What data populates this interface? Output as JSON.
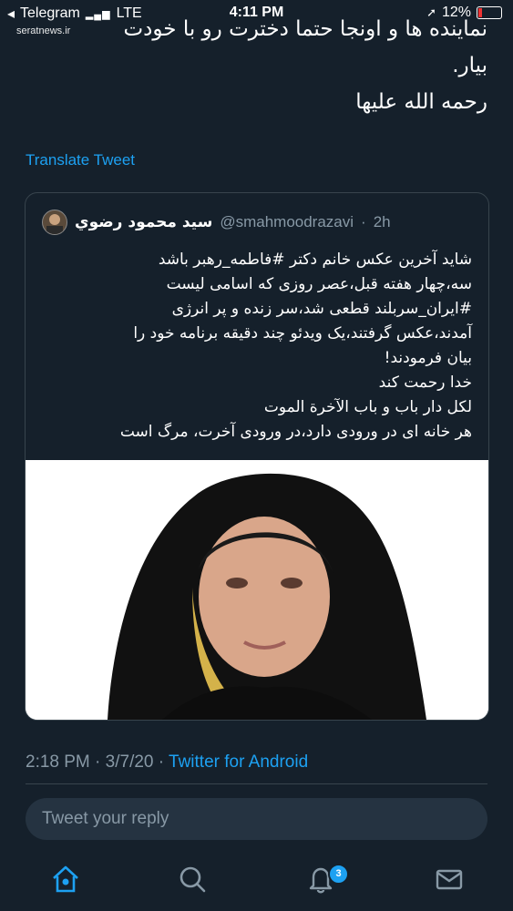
{
  "status_bar": {
    "carrier": "Telegram",
    "network": "LTE",
    "time": "4:11 PM",
    "battery": "12%"
  },
  "watermark": "seratnews.ir",
  "tweet_text_tail": "نماینده ها و اونجا حتما دخترت رو با خودت\nبیار.\nرحمه الله علیها",
  "translate_label": "Translate Tweet",
  "quoted_tweet": {
    "name": "سید محمود رضوي",
    "handle": "@smahmoodrazavi",
    "age": "2h",
    "text": "شاید آخرین عکس خانم دکتر #فاطمه_رهبر باشد\nسه،چهار هفته قبل،عصر روزی که اسامی لیست\n#ایران_سربلند قطعی شد،سر زنده و پر انرژی\nآمدند،عکس گرفتند،یک ویدئو چند دقیقه برنامه خود را\nبیان فرمودند!\nخدا رحمت کند\nلکل دار باب و باب الآخرة الموت\nهر خانه ای در ورودی دارد،در ورودی آخرت، مرگ است"
  },
  "timestamp": {
    "time": "2:18 PM",
    "date": "3/7/20",
    "source": "Twitter for Android"
  },
  "reply": {
    "placeholder": "Tweet your reply"
  },
  "tabs": [
    {
      "icon": "home-icon"
    },
    {
      "icon": "search-icon"
    },
    {
      "icon": "bell-icon",
      "badge": "3"
    },
    {
      "icon": "mail-icon"
    }
  ],
  "colors": {
    "background": "#15202b",
    "accent": "#1da1f2",
    "muted": "#8899a6",
    "border": "#38444d"
  }
}
